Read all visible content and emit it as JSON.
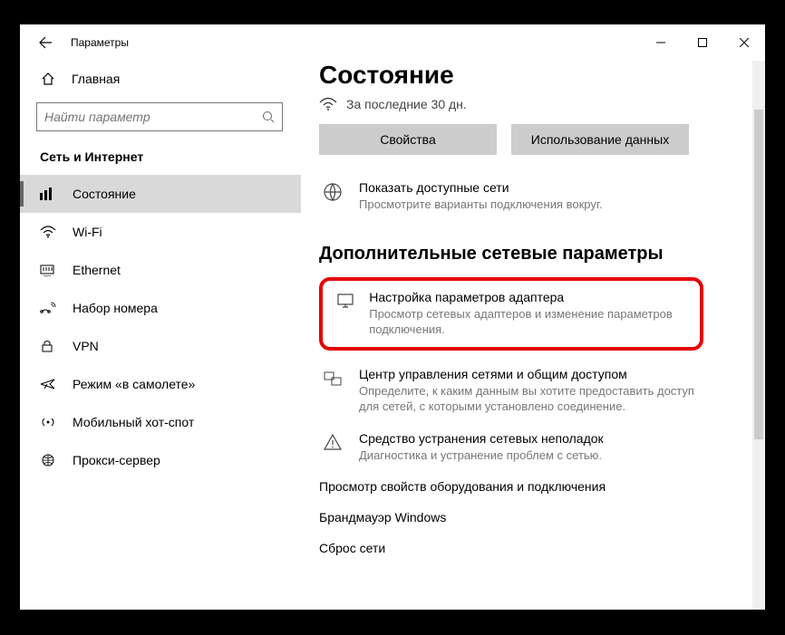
{
  "window": {
    "title": "Параметры"
  },
  "sidebar": {
    "home_label": "Главная",
    "search_placeholder": "Найти параметр",
    "section": "Сеть и Интернет",
    "items": [
      {
        "label": "Состояние"
      },
      {
        "label": "Wi-Fi"
      },
      {
        "label": "Ethernet"
      },
      {
        "label": "Набор номера"
      },
      {
        "label": "VPN"
      },
      {
        "label": "Режим «в самолете»"
      },
      {
        "label": "Мобильный хот-спот"
      },
      {
        "label": "Прокси-сервер"
      }
    ]
  },
  "main": {
    "title": "Состояние",
    "subline": "За последние 30 дн.",
    "buttons": {
      "properties": "Свойства",
      "usage": "Использование данных"
    },
    "available": {
      "title": "Показать доступные сети",
      "desc": "Просмотрите варианты подключения вокруг."
    },
    "section2": "Дополнительные сетевые параметры",
    "adapter": {
      "title": "Настройка параметров адаптера",
      "desc": "Просмотр сетевых адаптеров и изменение параметров подключения."
    },
    "sharing": {
      "title": "Центр управления сетями и общим доступом",
      "desc": "Определите, к каким данным вы хотите предоставить доступ для сетей, с которыми установлено соединение."
    },
    "troubleshoot": {
      "title": "Средство устранения сетевых неполадок",
      "desc": "Диагностика и устранение проблем с сетью."
    },
    "link_hw": "Просмотр свойств оборудования и подключения",
    "link_fw": "Брандмауэр Windows",
    "link_reset": "Сброс сети"
  }
}
